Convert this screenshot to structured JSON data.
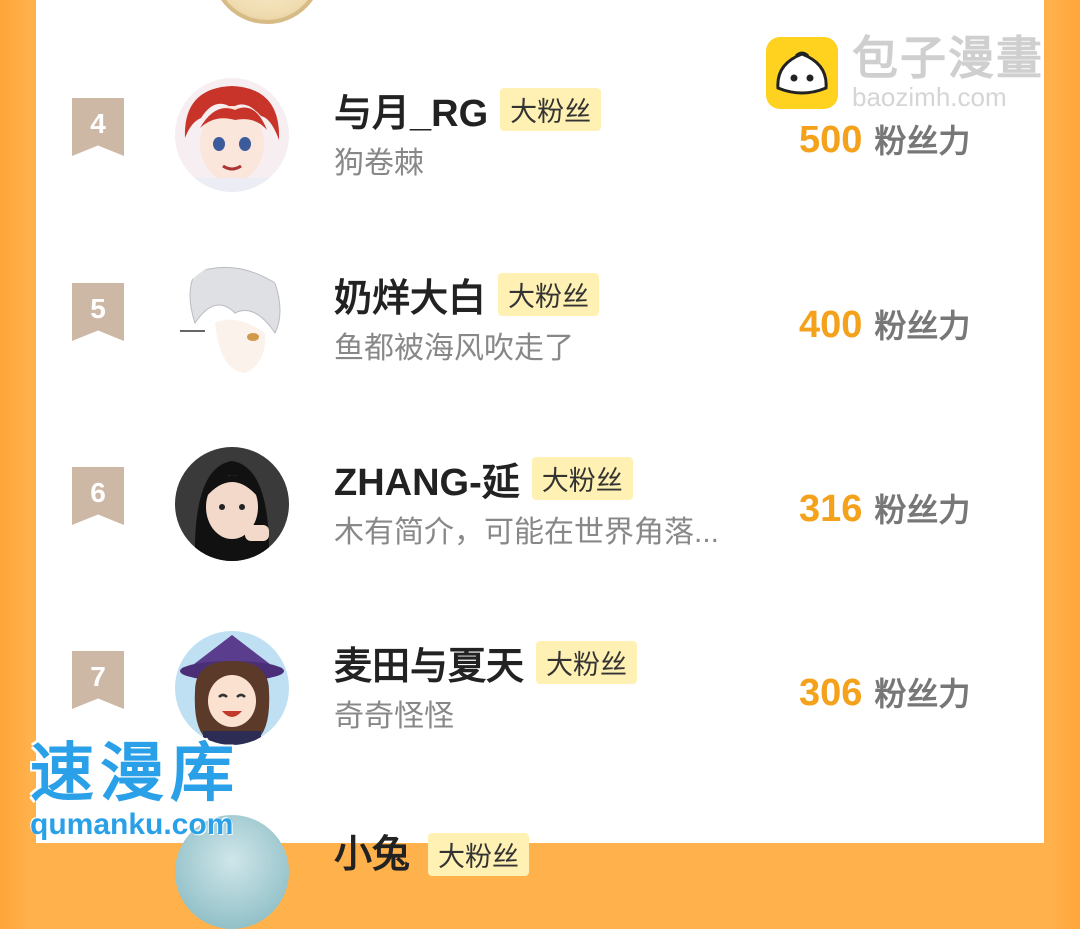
{
  "logo": {
    "title": "包子漫畫",
    "url": "baozimh.com"
  },
  "watermark": {
    "title": "速漫库",
    "url": "qumanku.com"
  },
  "ranking": [
    {
      "rank": "4",
      "name": "与月_RG",
      "badge": "大粉丝",
      "bio": "狗卷棘",
      "score": "500",
      "unit": "粉丝力"
    },
    {
      "rank": "5",
      "name": "奶烊大白",
      "badge": "大粉丝",
      "bio": "鱼都被海风吹走了",
      "score": "400",
      "unit": "粉丝力"
    },
    {
      "rank": "6",
      "name": "ZHANG-延",
      "badge": "大粉丝",
      "bio": "木有简介，可能在世界角落...",
      "score": "316",
      "unit": "粉丝力"
    },
    {
      "rank": "7",
      "name": "麦田与夏天",
      "badge": "大粉丝",
      "bio": "奇奇怪怪",
      "score": "306",
      "unit": "粉丝力"
    }
  ],
  "next_row": {
    "name": "小兔",
    "badge": "大粉丝"
  },
  "colors": {
    "accent": "#f4a11c",
    "background": "#ffb24c",
    "badge_bg": "#fff1b3",
    "rank_bg": "#cdb8a6",
    "watermark": "#2aa0e8"
  }
}
